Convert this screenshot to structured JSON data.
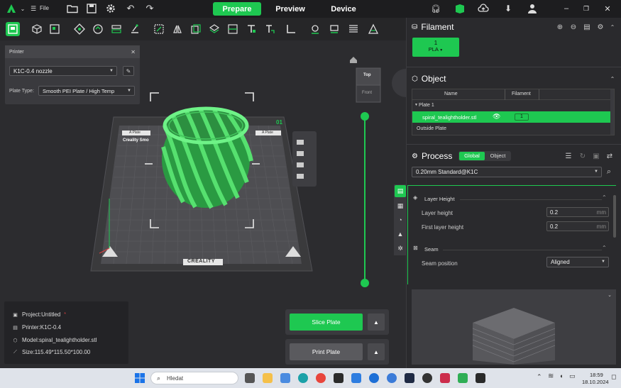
{
  "titlebar": {
    "file_label": "File",
    "tabs": [
      {
        "label": "Prepare",
        "active": true
      },
      {
        "label": "Preview",
        "active": false
      },
      {
        "label": "Device",
        "active": false
      }
    ]
  },
  "printer_panel": {
    "title": "Printer",
    "printer_value": "K1C-0.4 nozzle",
    "plate_type_label": "Plate Type:",
    "plate_type_value": "Smooth PEI Plate / High Temp"
  },
  "viewport": {
    "view_cube_top": "Top",
    "view_cube_front": "Front",
    "plate_number": "01",
    "plate_label_left": "A Plate",
    "plate_label_right": "A Plate",
    "plate_brand_top": "Creality Smo",
    "plate_brand_bottom": "CREALITY"
  },
  "info": {
    "project": "Project:Untitled",
    "printer": "Printer:K1C-0.4",
    "model": "Model:spiral_tealightholder.stl",
    "size": "Size:115.49*115.50*100.00"
  },
  "actions": {
    "slice": "Slice Plate",
    "print": "Print Plate"
  },
  "filament": {
    "title": "Filament",
    "slot_number": "1",
    "slot_type": "PLA"
  },
  "object": {
    "title": "Object",
    "col_name": "Name",
    "col_filament": "Filament",
    "plate_row": "Plate 1",
    "model_row": "spiral_tealightholder.stl",
    "model_filament": "1",
    "outside_row": "Outside Plate"
  },
  "process": {
    "title": "Process",
    "toggle_global": "Global",
    "toggle_object": "Object",
    "profile": "0.20mm Standard@K1C",
    "layer_height_section": "Layer Height",
    "layer_height_label": "Layer height",
    "layer_height_value": "0.2",
    "layer_height_unit": "mm",
    "first_layer_label": "First layer height",
    "first_layer_value": "0.2",
    "first_layer_unit": "mm",
    "seam_section": "Seam",
    "seam_position_label": "Seam position",
    "seam_position_value": "Aligned"
  },
  "taskbar": {
    "search_placeholder": "Hledat",
    "time": "18:59",
    "date": "18.10.2024"
  },
  "colors": {
    "accent": "#1ec851",
    "background": "#2b2b2e",
    "panel": "#3a3a3e",
    "model": "#3ed35e"
  }
}
